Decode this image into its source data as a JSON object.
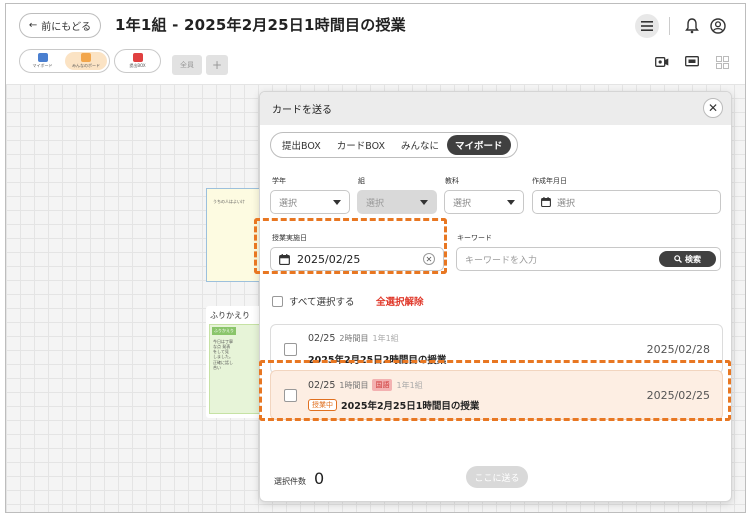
{
  "header": {
    "back_label": "前にもどる",
    "title": "1年1組 - 2025年2月25日1時間目の授業"
  },
  "toolbar": {
    "tool_group_1": [
      {
        "label": "マイボード",
        "color": "#4a7fd0"
      },
      {
        "label": "みんなのボード",
        "color": "#f2a64c"
      }
    ],
    "tool_group_2": [
      {
        "label": "提出BOX",
        "color": "#e04040"
      }
    ],
    "tab_all": "全員",
    "tab_add": "+"
  },
  "canvas": {
    "note_text": "うちの人はよいけ",
    "card_title": "ふりかえり",
    "card_tag": "ふりかえり",
    "card_text": "今日は丁寧な点 発表をして見 しました。 ",
    "card_text2": "正確に話し合い"
  },
  "modal": {
    "title": "カードを送る",
    "close_icon": "close-icon",
    "tabs": [
      {
        "label": "提出BOX",
        "active": false
      },
      {
        "label": "カードBOX",
        "active": false
      },
      {
        "label": "みんなに",
        "active": false
      },
      {
        "label": "マイボード",
        "active": true
      }
    ],
    "filters": {
      "grade_label": "学年",
      "grade_value": "選択",
      "class_label": "組",
      "class_value": "選択",
      "subject_label": "教科",
      "subject_value": "選択",
      "created_label": "作成年月日",
      "created_value": "選択"
    },
    "lesson_date_label": "授業実施日",
    "lesson_date_value": "2025/02/25",
    "keyword_label": "キーワード",
    "keyword_placeholder": "キーワードを入力",
    "search_label": "検索",
    "select_all": "すべて選択する",
    "deselect_all": "全選択解除",
    "items": [
      {
        "date": "02/25",
        "period": "2時間目",
        "grade": "1年1組",
        "subject": "",
        "status": "",
        "title": "2025年2月25日2時間目の授業",
        "right_date": "2025/02/28"
      },
      {
        "date": "02/25",
        "period": "1時間目",
        "grade": "1年1組",
        "subject": "国語",
        "status": "授業中",
        "title": "2025年2月25日1時間目の授業",
        "right_date": "2025/02/25"
      }
    ],
    "selected_count_label": "選択件数",
    "selected_count": "0",
    "send_label": "ここに送る"
  },
  "colors": {
    "highlight_dash": "#e87722",
    "active_tab_bg": "#404040",
    "deselect_red": "#e0392b",
    "highlight_row_bg": "#fdeee3"
  }
}
